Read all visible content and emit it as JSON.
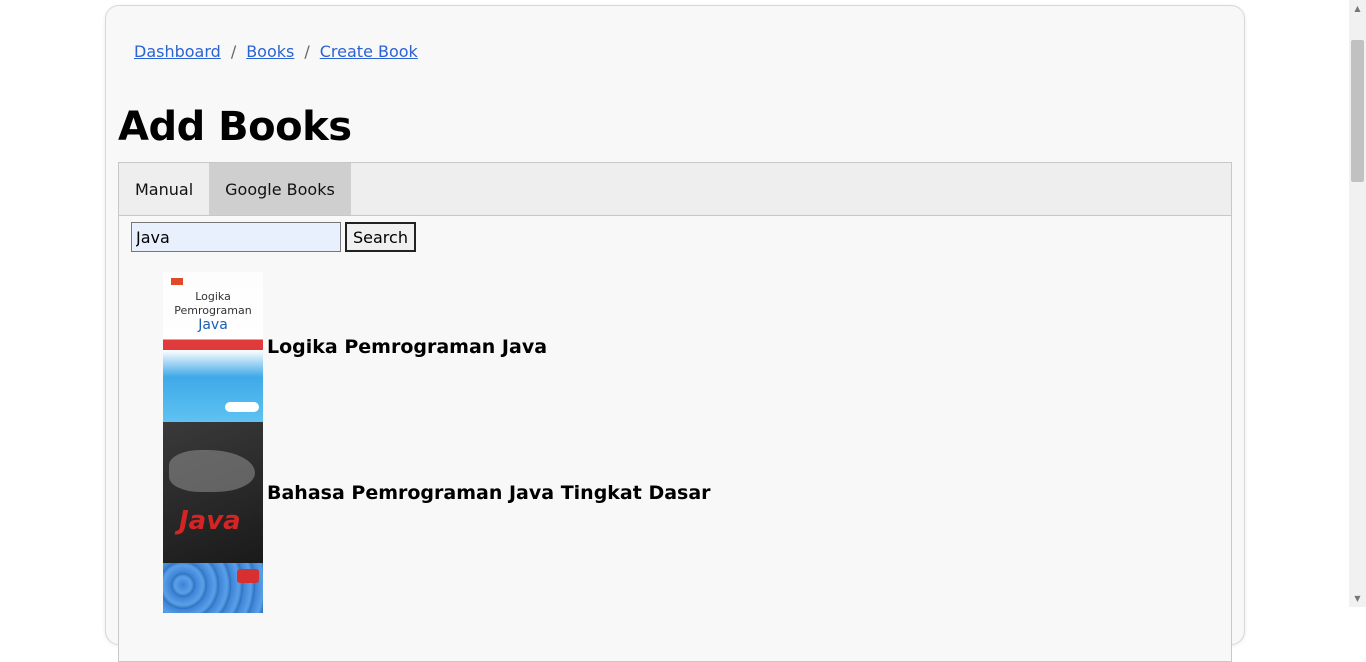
{
  "breadcrumb": {
    "items": [
      "Dashboard",
      "Books",
      "Create Book"
    ],
    "separator": "/"
  },
  "page_title": "Add Books",
  "tabs": [
    {
      "label": "Manual",
      "active": false
    },
    {
      "label": "Google Books",
      "active": true
    }
  ],
  "search": {
    "value": "Java",
    "button_label": "Search"
  },
  "results": [
    {
      "title": "Logika Pemrograman Java",
      "cover_text_1": "Logika",
      "cover_text_2": "Pemrograman",
      "cover_text_3": "Java"
    },
    {
      "title": "Bahasa Pemrograman Java Tingkat Dasar",
      "cover_text": "Java"
    },
    {
      "title": ""
    }
  ],
  "colors": {
    "link": "#2b63d1",
    "active_tab": "#cfcfcf",
    "tabbar": "#eeeeee",
    "card_bg": "#f8f8f9",
    "input_bg": "#e8f0fe"
  },
  "icons": {
    "scroll_up": "triangle-up-icon",
    "scroll_down": "triangle-down-icon"
  }
}
